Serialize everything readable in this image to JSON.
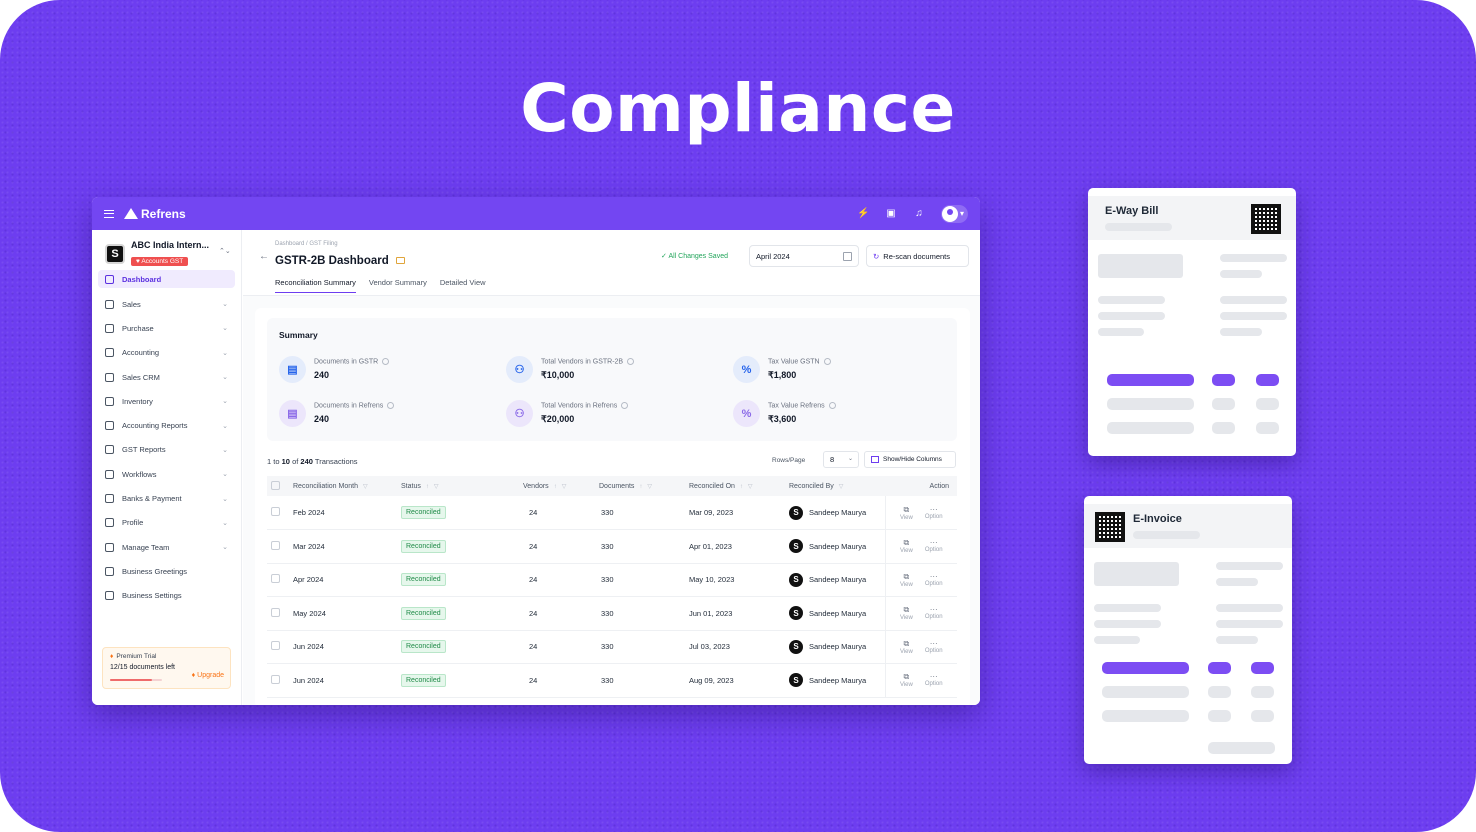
{
  "hero": {
    "title": "Compliance"
  },
  "topbar": {
    "brand": "Refrens",
    "icons": [
      "menu-icon",
      "bolt-icon",
      "gift-icon",
      "bell-icon",
      "avatar-icon"
    ]
  },
  "sidebar": {
    "org_name": "ABC India Intern...",
    "org_badge": "Accounts GST",
    "items": [
      {
        "label": "Dashboard",
        "active": true
      },
      {
        "label": "Sales"
      },
      {
        "label": "Purchase"
      },
      {
        "label": "Accounting"
      },
      {
        "label": "Sales CRM"
      },
      {
        "label": "Inventory"
      },
      {
        "label": "Accounting Reports"
      },
      {
        "label": "GST Reports"
      },
      {
        "label": "Workflows"
      },
      {
        "label": "Banks & Payment"
      },
      {
        "label": "Profile"
      },
      {
        "label": "Manage Team"
      },
      {
        "label": "Business Greetings"
      },
      {
        "label": "Business Settings"
      }
    ],
    "trial": {
      "title": "Premium Trial",
      "count": "12/15 documents left",
      "upgrade": "Upgrade",
      "progress": 0.8
    }
  },
  "page": {
    "breadcrumb": "Dashboard  /  GST Filing",
    "title": "GSTR-2B Dashboard",
    "saved": "All Changes Saved",
    "month": "April 2024",
    "rescan": "Re-scan documents",
    "tabs": [
      "Reconciliation Summary",
      "Vendor Summary",
      "Detailed View"
    ]
  },
  "summary": {
    "title": "Summary",
    "stats": [
      {
        "label": "Documents in GSTR",
        "value": "240",
        "icon": "doc-icon"
      },
      {
        "label": "Total Vendors in GSTR-2B",
        "value": "₹10,000",
        "icon": "users-icon"
      },
      {
        "label": "Tax Value GSTN",
        "value": "₹1,800",
        "icon": "percent-icon"
      },
      {
        "label": "Documents in Refrens",
        "value": "240",
        "icon": "doc-icon"
      },
      {
        "label": "Total Vendors in Refrens",
        "value": "₹20,000",
        "icon": "users-icon"
      },
      {
        "label": "Tax Value Refrens",
        "value": "₹3,600",
        "icon": "percent-icon"
      }
    ]
  },
  "table": {
    "count_from": "1",
    "count_to_word": "to",
    "count_to": "10",
    "count_of": "of",
    "count_total": "240",
    "count_suffix": "Transactions",
    "rows_per_page_label": "Rows/Page",
    "rows_per_page": "8",
    "show_hide": "Show/Hide Columns",
    "columns": [
      "Reconciliation Month",
      "Status",
      "Vendors",
      "Documents",
      "Reconciled On",
      "Reconciled By",
      "Action"
    ],
    "action_view": "View",
    "action_option": "Option",
    "rows": [
      {
        "month": "Feb 2024",
        "status": "Reconciled",
        "vendors": "24",
        "documents": "330",
        "on": "Mar 09, 2023",
        "by": "Sandeep Maurya"
      },
      {
        "month": "Mar 2024",
        "status": "Reconciled",
        "vendors": "24",
        "documents": "330",
        "on": "Apr 01, 2023",
        "by": "Sandeep Maurya"
      },
      {
        "month": "Apr 2024",
        "status": "Reconciled",
        "vendors": "24",
        "documents": "330",
        "on": "May 10, 2023",
        "by": "Sandeep Maurya"
      },
      {
        "month": "May 2024",
        "status": "Reconciled",
        "vendors": "24",
        "documents": "330",
        "on": "Jun 01, 2023",
        "by": "Sandeep Maurya"
      },
      {
        "month": "Jun 2024",
        "status": "Reconciled",
        "vendors": "24",
        "documents": "330",
        "on": "Jul 03, 2023",
        "by": "Sandeep Maurya"
      },
      {
        "month": "Jun 2024",
        "status": "Reconciled",
        "vendors": "24",
        "documents": "330",
        "on": "Aug 09, 2023",
        "by": "Sandeep Maurya"
      }
    ]
  },
  "cards": {
    "eway_title": "E-Way Bill",
    "einvoice_title": "E-Invoice"
  },
  "colors": {
    "brand": "#7346f2",
    "background": "#6d3df0",
    "success": "#22a55b"
  }
}
